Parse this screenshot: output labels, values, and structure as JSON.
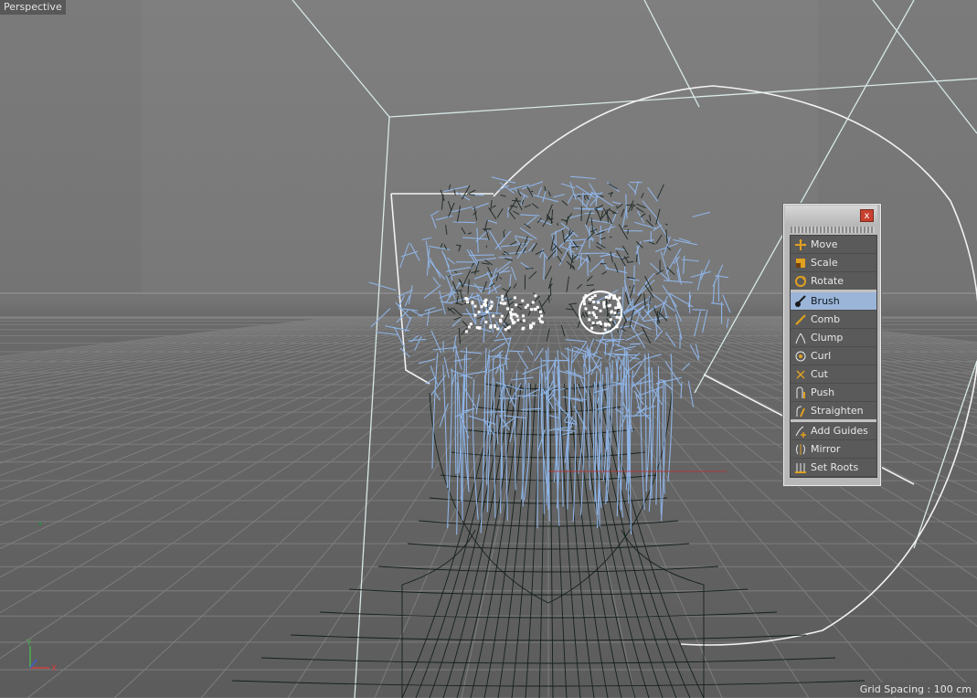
{
  "viewport": {
    "label": "Perspective",
    "grid_spacing": "Grid Spacing : 100 cm",
    "axis_x": "X",
    "axis_y": "Y"
  },
  "palette": {
    "close_label": "x",
    "tools": [
      {
        "label": "Move",
        "icon": "move-icon",
        "group": 1
      },
      {
        "label": "Scale",
        "icon": "scale-icon",
        "group": 1
      },
      {
        "label": "Rotate",
        "icon": "rotate-icon",
        "group": 1
      },
      {
        "label": "Brush",
        "icon": "brush-icon",
        "group": 2,
        "active": true
      },
      {
        "label": "Comb",
        "icon": "comb-icon",
        "group": 2
      },
      {
        "label": "Clump",
        "icon": "clump-icon",
        "group": 2
      },
      {
        "label": "Curl",
        "icon": "curl-icon",
        "group": 2
      },
      {
        "label": "Cut",
        "icon": "cut-icon",
        "group": 2
      },
      {
        "label": "Push",
        "icon": "push-icon",
        "group": 2
      },
      {
        "label": "Straighten",
        "icon": "straighten-icon",
        "group": 2
      },
      {
        "label": "Add Guides",
        "icon": "add-guides-icon",
        "group": 3
      },
      {
        "label": "Mirror",
        "icon": "mirror-icon",
        "group": 3
      },
      {
        "label": "Set Roots",
        "icon": "set-roots-icon",
        "group": 3
      }
    ]
  },
  "colors": {
    "active_tool": "#9ab5d8",
    "hair_guides": "#8fb4e6",
    "mesh_wire": "#0d1a14",
    "selection": "#ffffff"
  }
}
